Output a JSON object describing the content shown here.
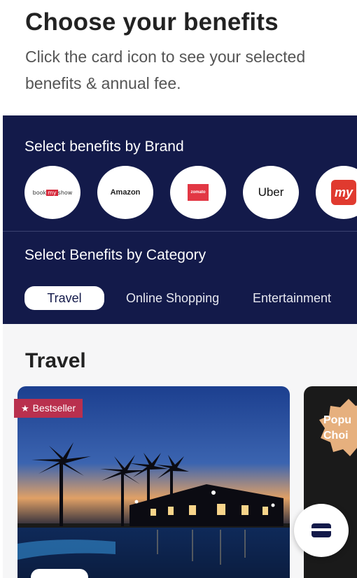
{
  "header": {
    "title": "Choose your benefits",
    "subtitle": "Click the card icon to see your selected benefits & annual fee."
  },
  "brands": {
    "heading": "Select benefits by Brand",
    "items": [
      {
        "label_a": "book",
        "label_b": "my",
        "label_c": "show",
        "icon": "bookmyshow-logo"
      },
      {
        "label": "Amazon",
        "icon": "amazon-logo"
      },
      {
        "label": "zomato",
        "icon": "zomato-logo",
        "color": "#e23744"
      },
      {
        "label": "Uber",
        "icon": "uber-logo"
      },
      {
        "label": "my",
        "icon": "makemytrip-logo",
        "color": "#e03a2f"
      }
    ]
  },
  "categories": {
    "heading": "Select Benefits by Category",
    "tabs": [
      {
        "label": "Travel",
        "active": true
      },
      {
        "label": "Online Shopping",
        "active": false
      },
      {
        "label": "Entertainment",
        "active": false
      }
    ]
  },
  "section": {
    "title": "Travel",
    "card": {
      "badge": "Bestseller",
      "badge_icon": "star-icon"
    },
    "next_card": {
      "badge": "Popular Choice",
      "badge_visible": "Popu Choi"
    }
  },
  "fab": {
    "icon": "card-icon"
  },
  "colors": {
    "navy": "#131a4a",
    "badge": "#b9304e",
    "popular": "#e6b07e"
  }
}
